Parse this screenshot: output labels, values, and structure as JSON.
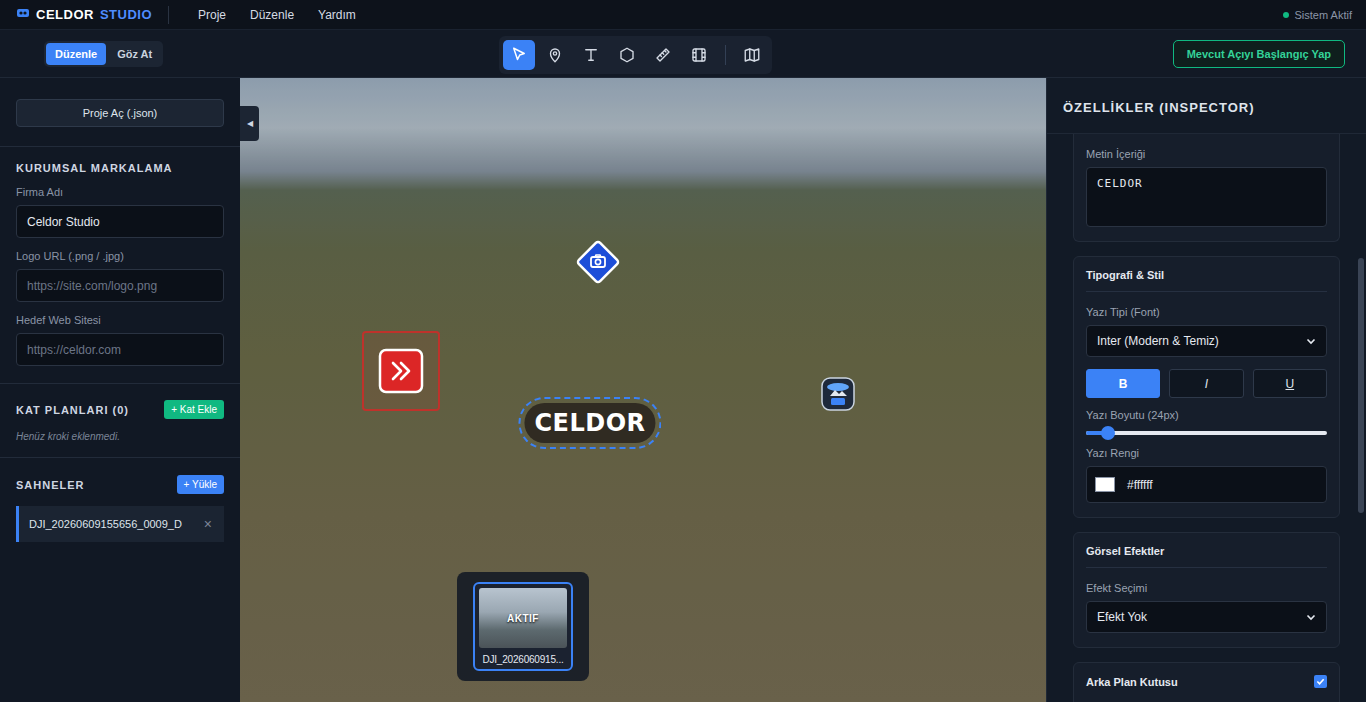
{
  "app": {
    "brand_1": "CELDOR",
    "brand_2": "STUDIO",
    "menu": [
      {
        "label": "Proje"
      },
      {
        "label": "Düzenle"
      },
      {
        "label": "Yardım"
      }
    ],
    "status": "Sistem Aktif"
  },
  "toolbar": {
    "modes": [
      {
        "label": "Düzenle",
        "selected": true
      },
      {
        "label": "Göz At",
        "selected": false
      }
    ],
    "tools": [
      {
        "kind": "pointer",
        "selected": true
      },
      {
        "kind": "pin",
        "selected": false
      },
      {
        "kind": "text",
        "selected": false
      },
      {
        "kind": "polygon",
        "selected": false
      },
      {
        "kind": "measure",
        "selected": false
      },
      {
        "kind": "film",
        "selected": false
      },
      {
        "kind": "map",
        "selected": false
      }
    ],
    "start_view_button": "Mevcut Açıyı Başlangıç Yap"
  },
  "sidebar": {
    "collapse": "◀",
    "open_project": "Proje Aç (.json)",
    "branding": {
      "title": "KURUMSAL MARKALAMA",
      "fields": [
        {
          "label": "Firma Adı",
          "value": "Celdor Studio"
        },
        {
          "label": "Logo URL (.png / .jpg)",
          "placeholder": "https://site.com/logo.png"
        },
        {
          "label": "Hedef Web Sitesi",
          "placeholder": "https://celdor.com"
        }
      ]
    },
    "floor_plans": {
      "title": "KAT PLANLARI (0)",
      "button": "+ Kat Ekle",
      "empty": "Henüz kroki eklenmedi."
    },
    "scenes": {
      "title": "SAHNELER",
      "button": "+ Yükle",
      "items": [
        {
          "name": "DJI_20260609155656_0009_D",
          "remove": "×",
          "selected": true
        }
      ]
    }
  },
  "viewer": {
    "hotspots": [
      {
        "kind": "camera",
        "selected": false
      },
      {
        "kind": "link",
        "selected": false
      },
      {
        "kind": "text",
        "label": "CELDOR",
        "selected": true
      },
      {
        "kind": "model3d",
        "selected": false
      }
    ],
    "scene_strip": [
      {
        "badge": "AKTIF",
        "label": "DJI_2026060915...",
        "selected": true
      }
    ]
  },
  "inspector": {
    "title": "ÖZELLİKLER (INSPECTOR)",
    "content": {
      "label": "Metin İçeriği",
      "value": "CELDOR"
    },
    "typography": {
      "title": "Tipografi & Stil",
      "font_label": "Yazı Tipi (Font)",
      "font_value": "Inter (Modern & Temiz)",
      "styles": [
        {
          "label": "B",
          "selected": true
        },
        {
          "label": "I",
          "selected": false
        },
        {
          "label": "U",
          "selected": false
        }
      ],
      "size_label": "Yazı Boyutu (24px)",
      "size_level": 0.09,
      "color_label": "Yazı Rengi",
      "color_value": "#ffffff",
      "color": "#ffffff"
    },
    "effects": {
      "title": "Görsel Efektler",
      "label": "Efekt Seçimi",
      "value": "Efekt Yok"
    },
    "background_box": {
      "title": "Arka Plan Kutusu",
      "checked": true
    }
  }
}
